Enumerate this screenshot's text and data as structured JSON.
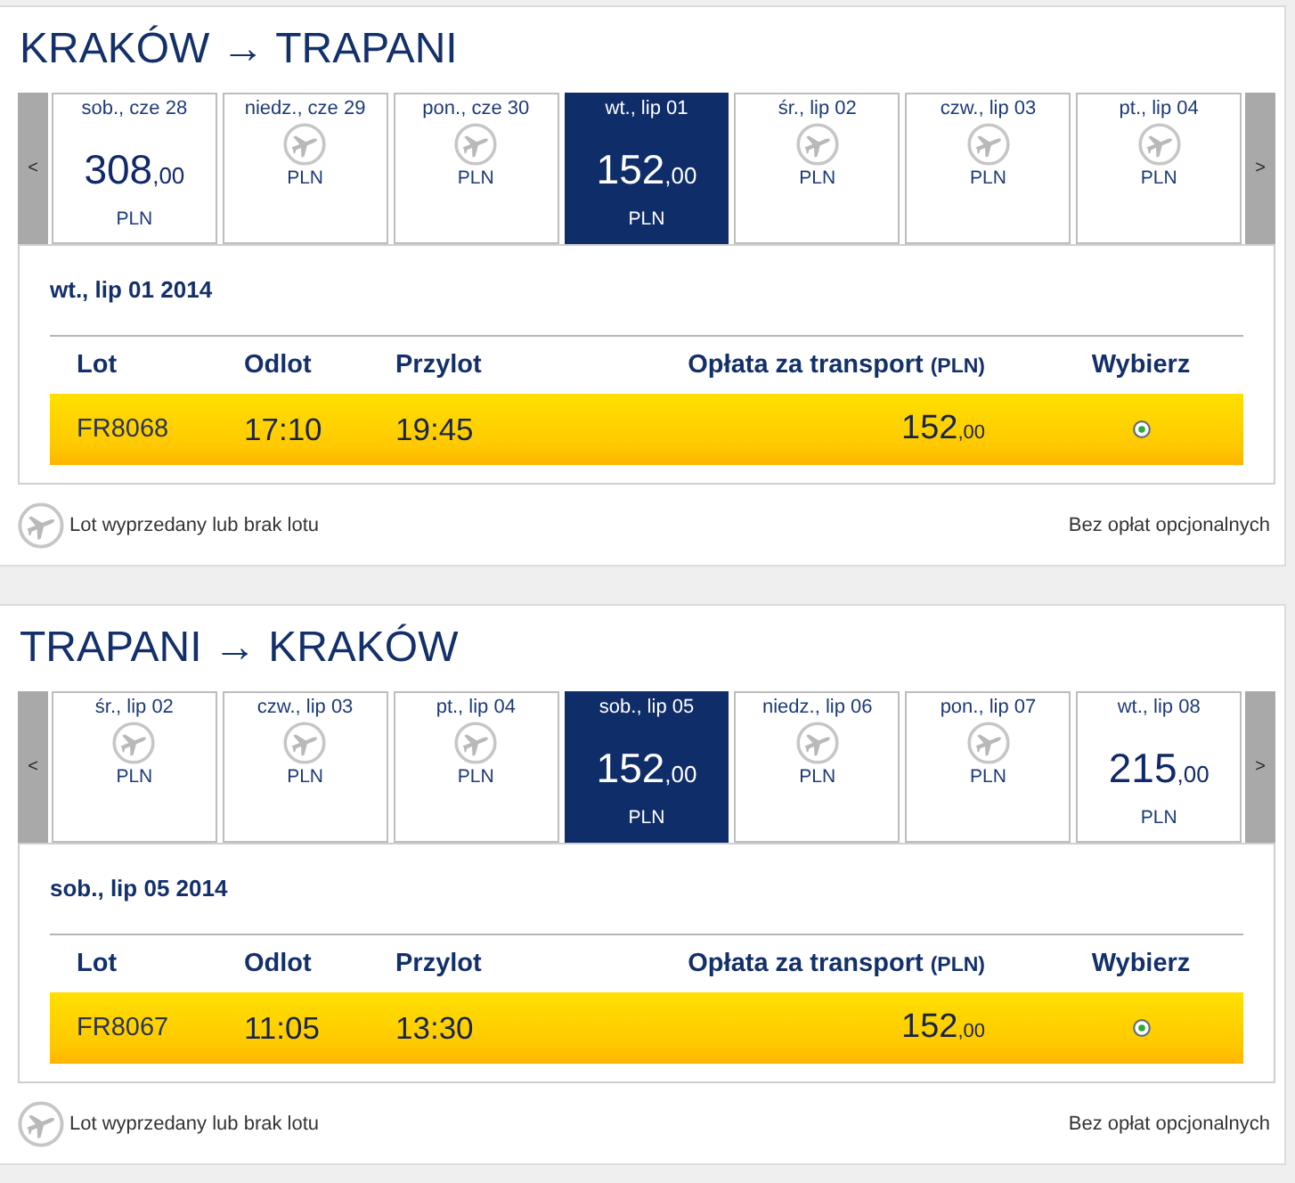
{
  "journeys": [
    {
      "title": "KRAKÓW → TRAPANI",
      "prev": "<",
      "next": ">",
      "days": [
        {
          "label": "sob., cze 28",
          "kind": "fare",
          "price": "308",
          "cents": ",00",
          "currency": "PLN",
          "selected": false
        },
        {
          "label": "niedz., cze 29",
          "kind": "sold_out",
          "currency": "PLN",
          "selected": false
        },
        {
          "label": "pon., cze 30",
          "kind": "sold_out",
          "currency": "PLN",
          "selected": false
        },
        {
          "label": "wt., lip 01",
          "kind": "fare",
          "price": "152",
          "cents": ",00",
          "currency": "PLN",
          "selected": true
        },
        {
          "label": "śr., lip 02",
          "kind": "sold_out",
          "currency": "PLN",
          "selected": false
        },
        {
          "label": "czw., lip 03",
          "kind": "sold_out",
          "currency": "PLN",
          "selected": false
        },
        {
          "label": "pt., lip 04",
          "kind": "sold_out",
          "currency": "PLN",
          "selected": false
        }
      ],
      "date": "wt., lip 01 2014",
      "columns": [
        {
          "label": "Lot"
        },
        {
          "label": "Odlot"
        },
        {
          "label": "Przylot"
        },
        {
          "label": "Opłata za transport",
          "unit": "(PLN)"
        },
        {
          "label": "Wybierz"
        }
      ],
      "flights": [
        {
          "number": "FR8068",
          "departure": "17:10",
          "arrival": "19:45",
          "price": "152",
          "cents": ",00",
          "selected": true
        }
      ],
      "legend": "Lot wyprzedany lub brak lotu",
      "note": "Bez opłat opcjonalnych"
    },
    {
      "title": "TRAPANI → KRAKÓW",
      "prev": "<",
      "next": ">",
      "days": [
        {
          "label": "śr., lip 02",
          "kind": "sold_out",
          "currency": "PLN",
          "selected": false
        },
        {
          "label": "czw., lip 03",
          "kind": "sold_out",
          "currency": "PLN",
          "selected": false
        },
        {
          "label": "pt., lip 04",
          "kind": "sold_out",
          "currency": "PLN",
          "selected": false
        },
        {
          "label": "sob., lip 05",
          "kind": "fare",
          "price": "152",
          "cents": ",00",
          "currency": "PLN",
          "selected": true
        },
        {
          "label": "niedz., lip 06",
          "kind": "sold_out",
          "currency": "PLN",
          "selected": false
        },
        {
          "label": "pon., lip 07",
          "kind": "sold_out",
          "currency": "PLN",
          "selected": false
        },
        {
          "label": "wt., lip 08",
          "kind": "fare",
          "price": "215",
          "cents": ",00",
          "currency": "PLN",
          "selected": false
        }
      ],
      "date": "sob., lip 05 2014",
      "columns": [
        {
          "label": "Lot"
        },
        {
          "label": "Odlot"
        },
        {
          "label": "Przylot"
        },
        {
          "label": "Opłata za transport",
          "unit": "(PLN)"
        },
        {
          "label": "Wybierz"
        }
      ],
      "flights": [
        {
          "number": "FR8067",
          "departure": "11:05",
          "arrival": "13:30",
          "price": "152",
          "cents": ",00",
          "selected": true
        }
      ],
      "legend": "Lot wyprzedany lub brak lotu",
      "note": "Bez opłat opcjonalnych"
    }
  ]
}
